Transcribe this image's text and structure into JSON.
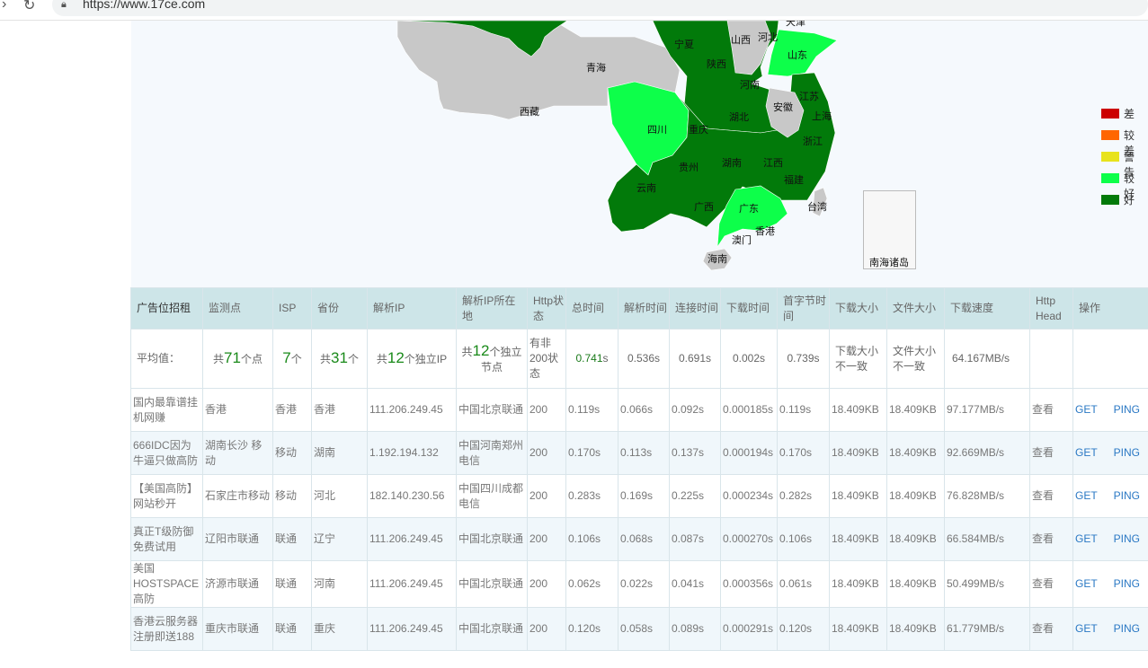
{
  "browser": {
    "url": "https://www.17ce.com"
  },
  "map": {
    "provinces": [
      "青海",
      "西藏",
      "宁夏",
      "山西",
      "河北",
      "天津",
      "陕西",
      "山东",
      "河南",
      "江苏",
      "四川",
      "湖北",
      "安徽",
      "上海",
      "重庆",
      "浙江",
      "贵州",
      "湖南",
      "江西",
      "福建",
      "云南",
      "广西",
      "广东",
      "台湾",
      "香港",
      "澳门",
      "海南"
    ],
    "inset_label": "南海诸岛",
    "colors": {
      "gray": "#c8c8c8",
      "good": "#027a0a",
      "better": "#0dff4a"
    }
  },
  "legend": [
    {
      "label": "差",
      "color": "#cc0000"
    },
    {
      "label": "较差",
      "color": "#ff6600"
    },
    {
      "label": "警告",
      "color": "#e8e31c"
    },
    {
      "label": "较好",
      "color": "#0dff4a"
    },
    {
      "label": "好",
      "color": "#027a0a"
    }
  ],
  "table": {
    "headers": [
      "广告位招租",
      "监测点",
      "ISP",
      "省份",
      "解析IP",
      "解析IP所在地",
      "Http状态",
      "总时间",
      "解析时间",
      "连接时间",
      "下载时间",
      "首字节时间",
      "下载大小",
      "文件大小",
      "下载速度",
      "Http Head",
      "操作"
    ],
    "average": {
      "label": "平均值：",
      "points_prefix": "共",
      "points_num": "71",
      "points_suffix": "个点",
      "isp_num": "7",
      "isp_suffix": "个",
      "prov_prefix": "共",
      "prov_num": "31",
      "prov_suffix": "个",
      "ip_prefix": "共",
      "ip_num": "12",
      "ip_suffix": "个独立IP",
      "node_prefix": "共",
      "node_num": "12",
      "node_suffix": "个独立节点",
      "http": "有非200状态",
      "total": "0.741",
      "dns": "0.536s",
      "connect": "0.691s",
      "download": "0.002s",
      "ttfb": "0.739s",
      "dl_size": "下载大小不一致",
      "file_size": "文件大小不一致",
      "speed": "64.167MB/s",
      "unit_s": "s"
    },
    "rows": [
      {
        "ad": "国内最靠谱挂机网赚",
        "point": "香港",
        "isp": "香港",
        "prov": "香港",
        "ip": "111.206.249.45",
        "loc": "中国北京联通",
        "http": "200",
        "total": "0.119",
        "dns": "0.066s",
        "connect": "0.092s",
        "download": "0.000185s",
        "ttfb": "0.119s",
        "dl_size": "18.409KB",
        "file_size": "18.409KB",
        "speed": "97.177MB/s",
        "head": "查看",
        "get": "GET",
        "ping": "PING"
      },
      {
        "ad": "666IDC因为牛逼只做高防",
        "point": "湖南长沙 移动",
        "isp": "移动",
        "prov": "湖南",
        "ip": "1.192.194.132",
        "loc": "中国河南郑州电信",
        "http": "200",
        "total": "0.170",
        "dns": "0.113s",
        "connect": "0.137s",
        "download": "0.000194s",
        "ttfb": "0.170s",
        "dl_size": "18.409KB",
        "file_size": "18.409KB",
        "speed": "92.669MB/s",
        "head": "查看",
        "get": "GET",
        "ping": "PING"
      },
      {
        "ad": "【美国高防】网站秒开",
        "point": "石家庄市移动",
        "isp": "移动",
        "prov": "河北",
        "ip": "182.140.230.56",
        "loc": "中国四川成都电信",
        "http": "200",
        "total": "0.283",
        "dns": "0.169s",
        "connect": "0.225s",
        "download": "0.000234s",
        "ttfb": "0.282s",
        "dl_size": "18.409KB",
        "file_size": "18.409KB",
        "speed": "76.828MB/s",
        "head": "查看",
        "get": "GET",
        "ping": "PING"
      },
      {
        "ad": "真正T级防御免费试用",
        "point": "辽阳市联通",
        "isp": "联通",
        "prov": "辽宁",
        "ip": "111.206.249.45",
        "loc": "中国北京联通",
        "http": "200",
        "total": "0.106",
        "dns": "0.068s",
        "connect": "0.087s",
        "download": "0.000270s",
        "ttfb": "0.106s",
        "dl_size": "18.409KB",
        "file_size": "18.409KB",
        "speed": "66.584MB/s",
        "head": "查看",
        "get": "GET",
        "ping": "PING"
      },
      {
        "ad": "美国HOSTSPACE高防",
        "point": "济源市联通",
        "isp": "联通",
        "prov": "河南",
        "ip": "111.206.249.45",
        "loc": "中国北京联通",
        "http": "200",
        "total": "0.062",
        "dns": "0.022s",
        "connect": "0.041s",
        "download": "0.000356s",
        "ttfb": "0.061s",
        "dl_size": "18.409KB",
        "file_size": "18.409KB",
        "speed": "50.499MB/s",
        "head": "查看",
        "get": "GET",
        "ping": "PING"
      },
      {
        "ad": "香港云服务器注册即送188",
        "point": "重庆市联通",
        "isp": "联通",
        "prov": "重庆",
        "ip": "111.206.249.45",
        "loc": "中国北京联通",
        "http": "200",
        "total": "0.120",
        "dns": "0.058s",
        "connect": "0.089s",
        "download": "0.000291s",
        "ttfb": "0.120s",
        "dl_size": "18.409KB",
        "file_size": "18.409KB",
        "speed": "61.779MB/s",
        "head": "查看",
        "get": "GET",
        "ping": "PING"
      }
    ]
  }
}
